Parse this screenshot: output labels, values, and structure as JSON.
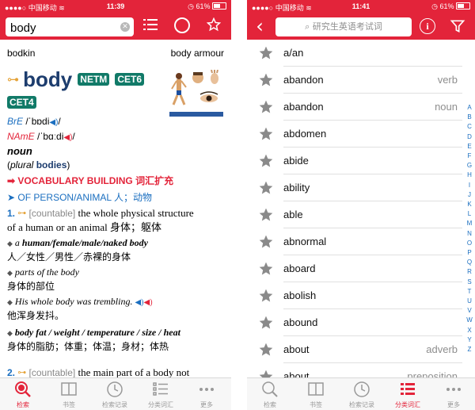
{
  "left": {
    "status": {
      "carrier": "中国移动",
      "time": "11:39",
      "battery": "61%"
    },
    "search": {
      "value": "body"
    },
    "neighbors": {
      "prev": "bodkin",
      "next": "body armour"
    },
    "entry": {
      "headword": "body",
      "badges": [
        "NETM",
        "CET6",
        "CET4"
      ],
      "pron_bre_label": "BrE",
      "pron_bre": "/ˈbɒdi",
      "pron_name_label": "NAmE",
      "pron_name": "/ˈbɑːdi",
      "pos": "noun",
      "plural_label": "plural",
      "plural": "bodies",
      "vocab": "VOCABULARY BUILDING 词汇扩充",
      "subsense": "OF PERSON/ANIMAL 人；动物",
      "sense1_num": "1.",
      "sense1_gram": "[countable]",
      "sense1_def_a": "the whole physical structure",
      "sense1_def_b": "of a human or an animal 身体；躯体",
      "ex1_en_a": "a ",
      "ex1_en_b": "human/female/male/naked body",
      "ex1_zh": "人／女性／男性／赤裸的身体",
      "ex2_en": "parts of the body",
      "ex2_zh": "身体的部位",
      "ex3_en": "His whole body was trembling.",
      "ex3_zh": "他浑身发抖。",
      "ex4_en": "body fat / weight / temperature / size / heat",
      "ex4_zh": "身体的脂肪；体重；体温；身材；体热",
      "sense2_num": "2.",
      "sense2_gram": "[countable]",
      "sense2_def": "the main part of a body not"
    },
    "tabs": [
      "检索",
      "书签",
      "检索记录",
      "分类词汇",
      "更多"
    ]
  },
  "right": {
    "status": {
      "carrier": "中国移动",
      "time": "11:41",
      "battery": "61%"
    },
    "search": {
      "placeholder": "研究生英语考试词"
    },
    "words": [
      {
        "word": "a/an",
        "tag": ""
      },
      {
        "word": "abandon",
        "tag": "verb"
      },
      {
        "word": "abandon",
        "tag": "noun"
      },
      {
        "word": "abdomen",
        "tag": ""
      },
      {
        "word": "abide",
        "tag": ""
      },
      {
        "word": "ability",
        "tag": ""
      },
      {
        "word": "able",
        "tag": ""
      },
      {
        "word": "abnormal",
        "tag": ""
      },
      {
        "word": "aboard",
        "tag": ""
      },
      {
        "word": "abolish",
        "tag": ""
      },
      {
        "word": "abound",
        "tag": ""
      },
      {
        "word": "about",
        "tag": "adverb"
      },
      {
        "word": "about",
        "tag": "preposition"
      }
    ],
    "index": [
      "A",
      "B",
      "C",
      "D",
      "E",
      "F",
      "G",
      "H",
      "I",
      "J",
      "K",
      "L",
      "M",
      "N",
      "O",
      "P",
      "Q",
      "R",
      "S",
      "T",
      "U",
      "V",
      "W",
      "X",
      "Y",
      "Z"
    ],
    "tabs": [
      "检索",
      "书签",
      "检索记录",
      "分类词汇",
      "更多"
    ]
  },
  "colors": {
    "accent": "#e3243a",
    "badge": "#117a68",
    "headword": "#1d3d6e",
    "link": "#1b6fc0"
  }
}
